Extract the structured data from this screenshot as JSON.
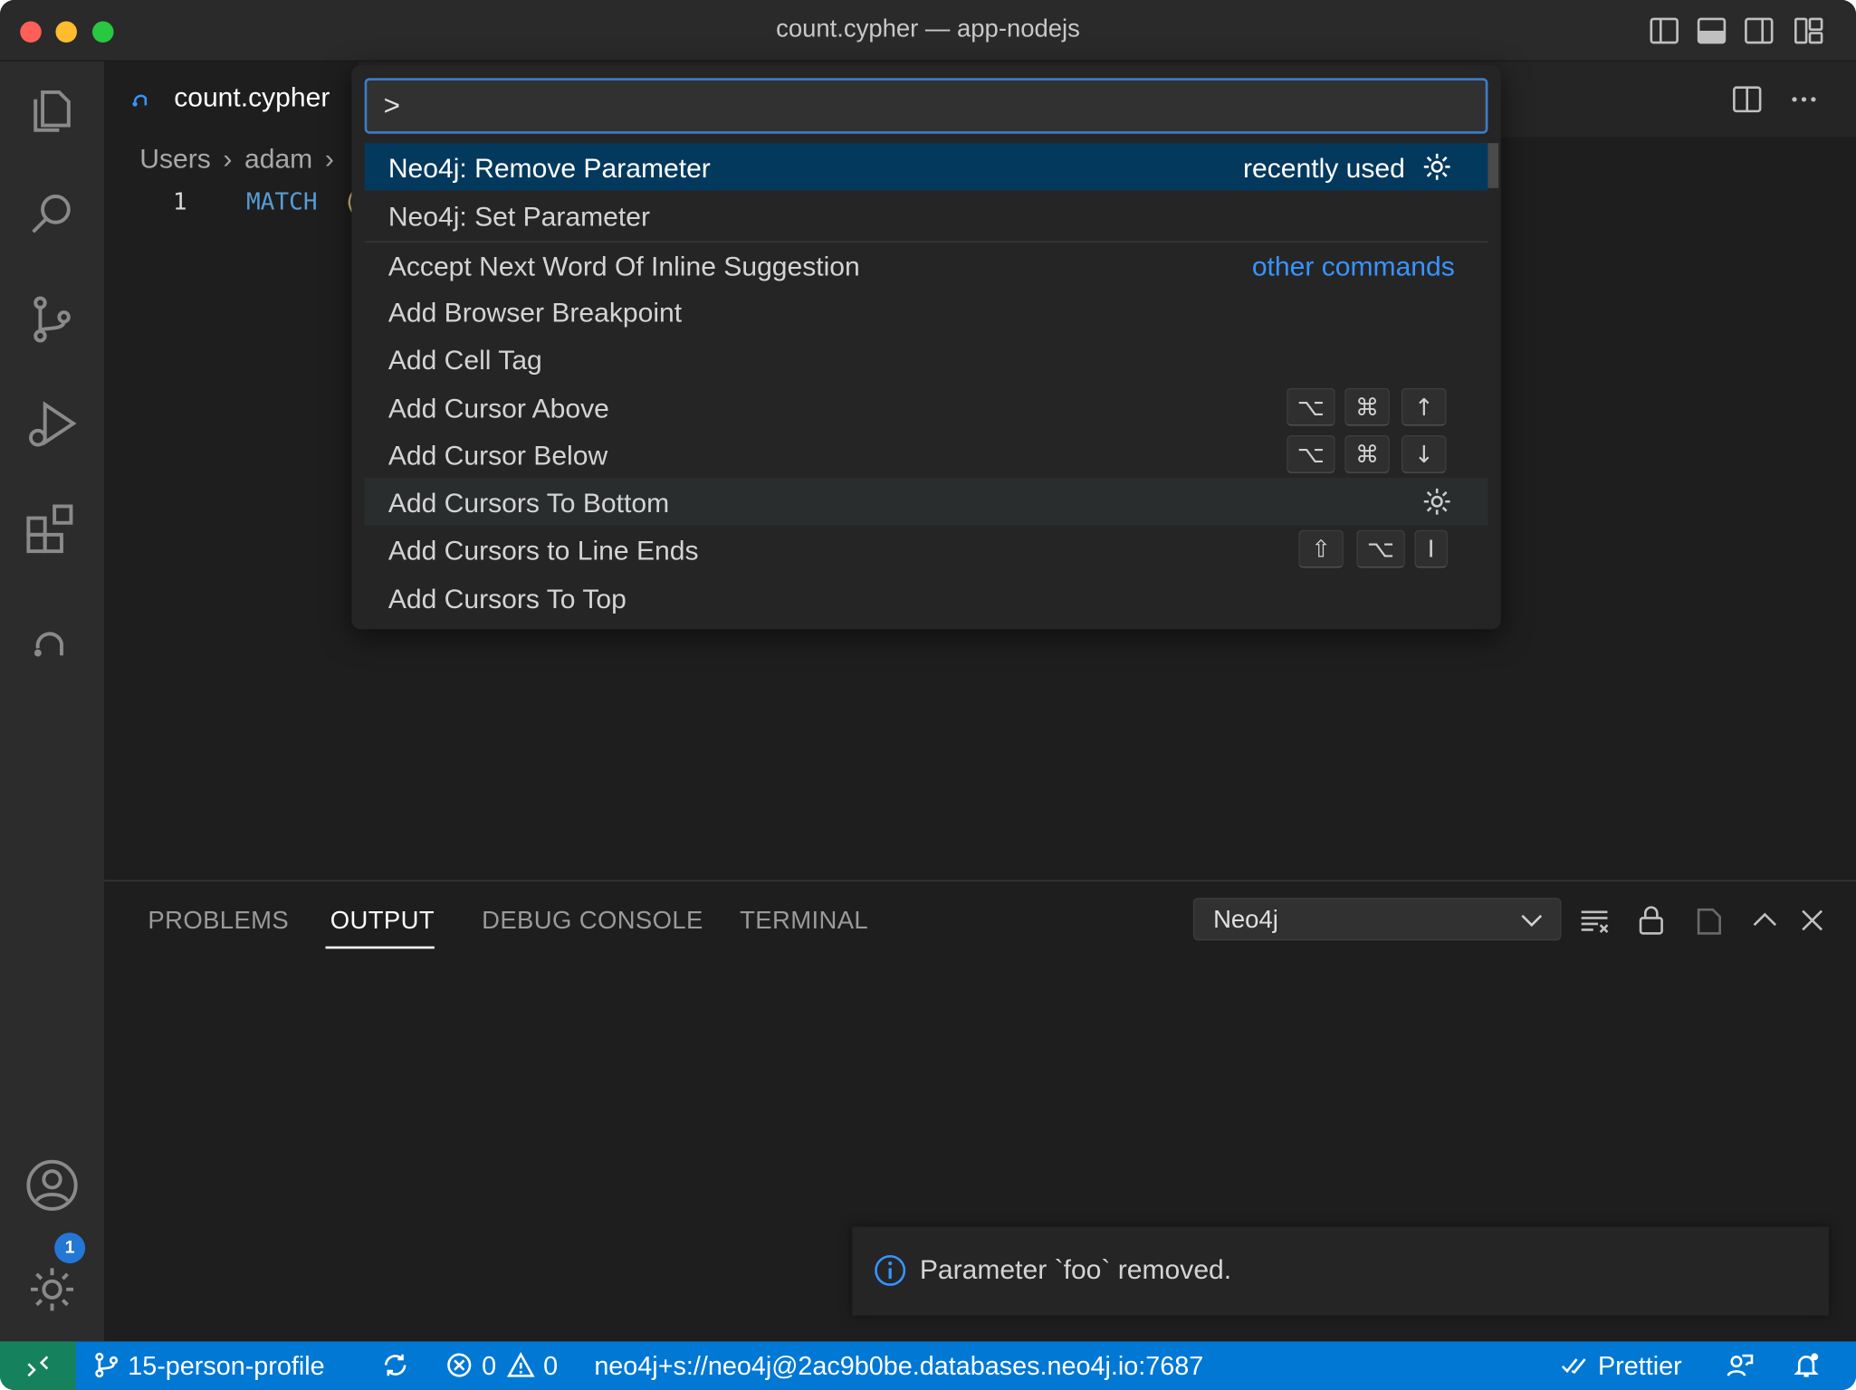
{
  "window": {
    "title": "count.cypher — app-nodejs"
  },
  "editor": {
    "tab": {
      "label": "count.cypher"
    },
    "breadcrumb": [
      "Users",
      "adam"
    ],
    "line_number": "1",
    "code_keyword": "MATCH",
    "code_rest": "("
  },
  "palette": {
    "input_value": ">",
    "hint_recent": "recently used",
    "hint_other": "other commands",
    "commands": [
      {
        "label": "Neo4j: Remove Parameter"
      },
      {
        "label": "Neo4j: Set Parameter"
      },
      {
        "label": "Accept Next Word Of Inline Suggestion"
      },
      {
        "label": "Add Browser Breakpoint"
      },
      {
        "label": "Add Cell Tag"
      },
      {
        "label": "Add Cursor Above",
        "keys": [
          "⌥",
          "⌘",
          "↑"
        ]
      },
      {
        "label": "Add Cursor Below",
        "keys": [
          "⌥",
          "⌘",
          "↓"
        ]
      },
      {
        "label": "Add Cursors To Bottom"
      },
      {
        "label": "Add Cursors to Line Ends",
        "keys": [
          "⇧",
          "⌥",
          "I"
        ]
      },
      {
        "label": "Add Cursors To Top"
      }
    ]
  },
  "panel": {
    "tabs": [
      "PROBLEMS",
      "OUTPUT",
      "DEBUG CONSOLE",
      "TERMINAL"
    ],
    "active_tab": "OUTPUT",
    "output_channel": "Neo4j"
  },
  "notification": {
    "message": "Parameter `foo` removed."
  },
  "activity": {
    "settings_badge": "1"
  },
  "statusbar": {
    "branch": "15-person-profile",
    "errors": "0",
    "warnings": "0",
    "connection": "neo4j+s://neo4j@2ac9b0be.databases.neo4j.io:7687",
    "prettier": "Prettier"
  },
  "colors": {
    "accent": "#0078d4",
    "selection": "#04395e",
    "link": "#3794ff",
    "remote": "#16825d"
  }
}
